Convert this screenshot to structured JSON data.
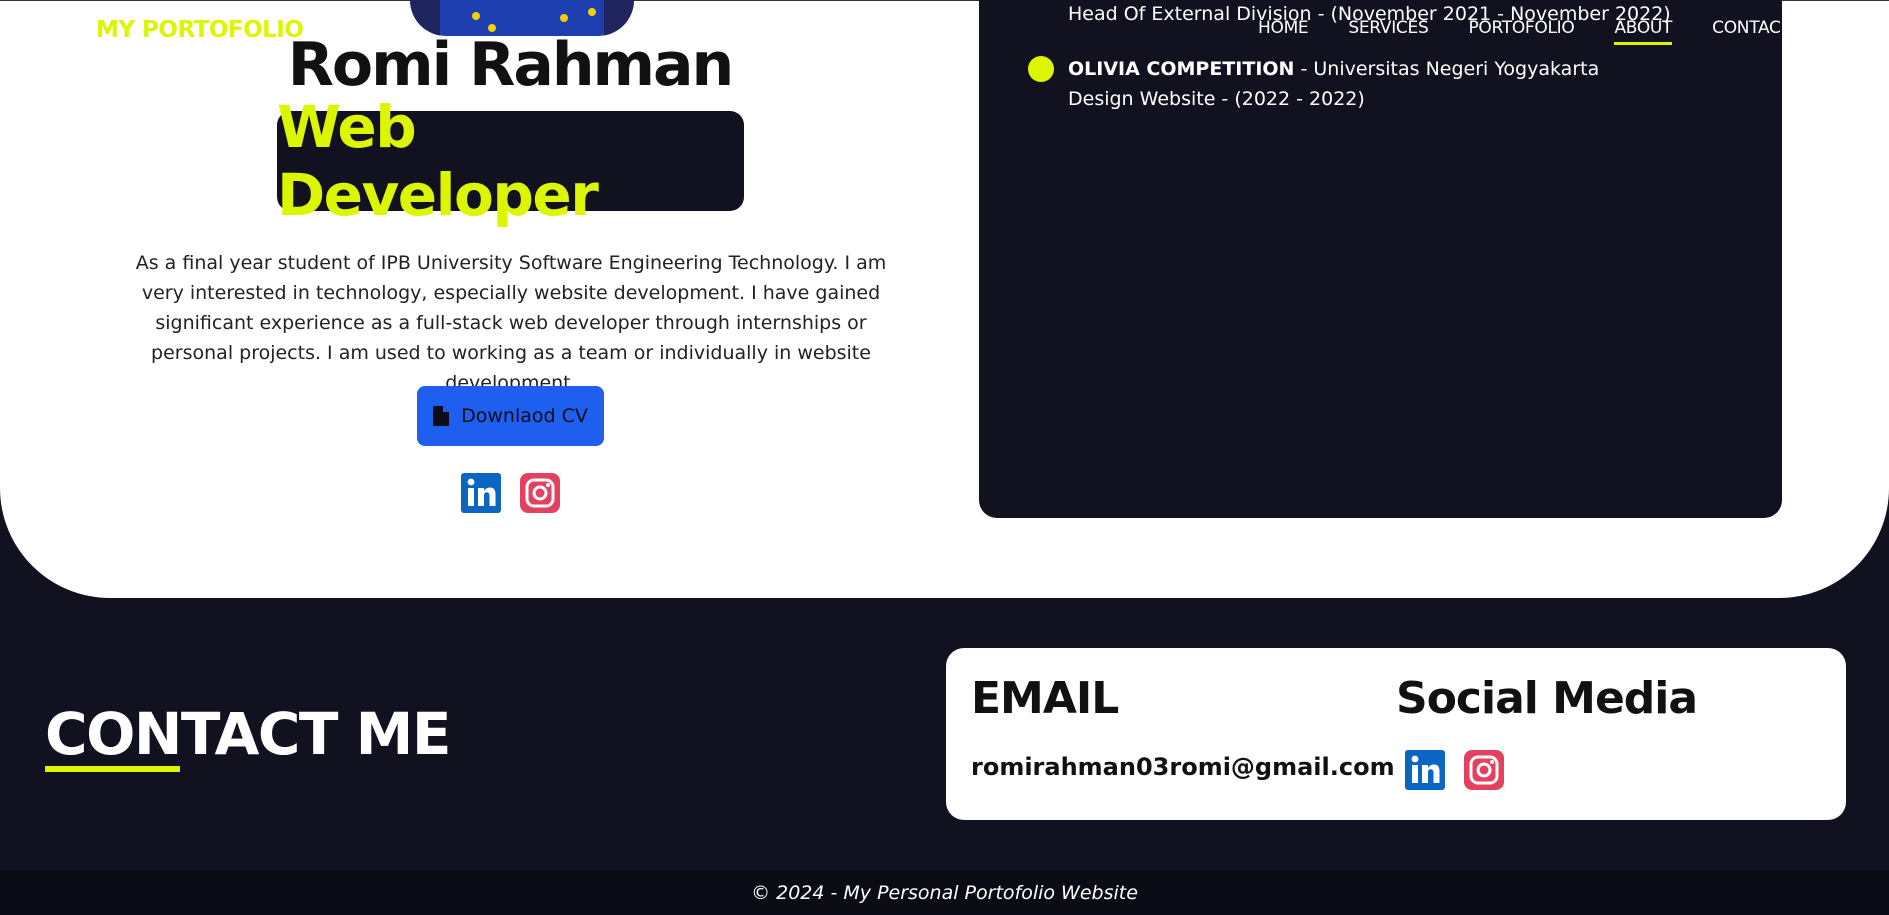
{
  "header": {
    "logo": "MY PORTOFOLIO",
    "nav": [
      {
        "label": "HOME"
      },
      {
        "label": "SERVICES"
      },
      {
        "label": "PORTOFOLIO"
      },
      {
        "label": "ABOUT",
        "active": true
      },
      {
        "label": "CONTAC"
      }
    ]
  },
  "profile": {
    "name": "Romi Rahman",
    "role": "Web Developer",
    "bio": "As a final year student of IPB University Software Engineering Technology. I am very interested in technology, especially website development. I have gained significant experience as a full-stack web developer through internships or personal projects. I am used to working as a team or individually in website development.",
    "cv_button": "Downlaod CV",
    "social_icons": [
      "linkedin-icon",
      "instagram-icon"
    ]
  },
  "experience": {
    "partial_line": "Head Of External Division - (November 2021 - November 2022)",
    "items": [
      {
        "title": "OLIVIA COMPETITION",
        "org": " - Universitas Negeri Yogyakarta",
        "detail": "Design Website - (2022 - 2022)"
      }
    ]
  },
  "contact": {
    "heading": "CONTACT ME",
    "email_heading": "EMAIL",
    "email": "romirahman03romi@gmail.com",
    "social_heading": "Social Media"
  },
  "footer": {
    "text": "© 2024 - My Personal Portofolio Website"
  },
  "colors": {
    "accent": "#dcf500",
    "dark": "#11111f",
    "button": "#1e5ff0",
    "linkedin": "#0a66c2",
    "instagram": "#e4405f"
  }
}
